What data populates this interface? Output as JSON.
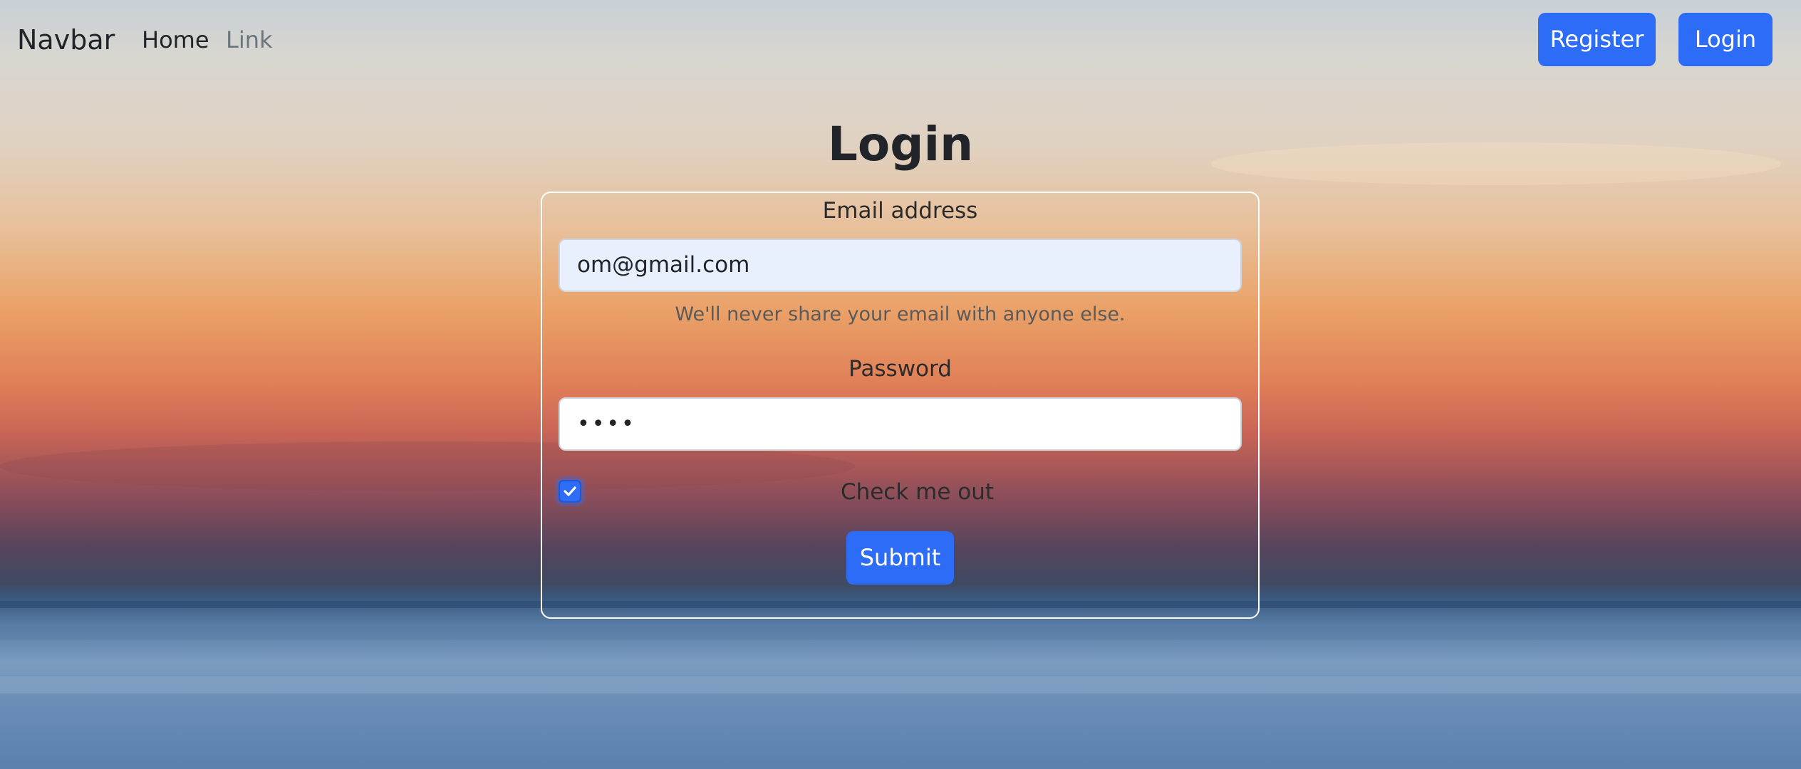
{
  "navbar": {
    "brand": "Navbar",
    "links": [
      {
        "label": "Home"
      },
      {
        "label": "Link"
      }
    ],
    "register_label": "Register",
    "login_label": "Login"
  },
  "page": {
    "title": "Login"
  },
  "form": {
    "email_label": "Email address",
    "email_value": "om@gmail.com",
    "email_help": "We'll never share your email with anyone else.",
    "password_label": "Password",
    "password_value": "••••",
    "checkbox_label": "Check me out",
    "checkbox_checked": true,
    "submit_label": "Submit"
  },
  "colors": {
    "primary": "#2d6cf6",
    "card_border": "#ffffff",
    "muted_link": "#6c757d"
  },
  "icons": {
    "checkbox_mark": "check-icon"
  }
}
